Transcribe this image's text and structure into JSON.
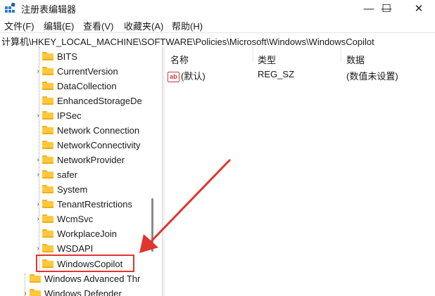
{
  "window": {
    "title": "注册表编辑器",
    "minimize": "—",
    "maximize": "☐",
    "close": "✕"
  },
  "menu": [
    "文件(F)",
    "编辑(E)",
    "查看(V)",
    "收藏夹(A)",
    "帮助(H)"
  ],
  "address": "计算机\\HKEY_LOCAL_MACHINE\\SOFTWARE\\Policies\\Microsoft\\Windows\\WindowsCopilot",
  "tree": {
    "items": [
      {
        "label": "BITS",
        "expandable": false
      },
      {
        "label": "CurrentVersion",
        "expandable": true
      },
      {
        "label": "DataCollection",
        "expandable": false
      },
      {
        "label": "EnhancedStorageDe",
        "expandable": false
      },
      {
        "label": "IPSec",
        "expandable": true
      },
      {
        "label": "Network Connection",
        "expandable": false
      },
      {
        "label": "NetworkConnectivity",
        "expandable": false
      },
      {
        "label": "NetworkProvider",
        "expandable": true
      },
      {
        "label": "safer",
        "expandable": true
      },
      {
        "label": "System",
        "expandable": false
      },
      {
        "label": "TenantRestrictions",
        "expandable": true
      },
      {
        "label": "WcmSvc",
        "expandable": true
      },
      {
        "label": "WorkplaceJoin",
        "expandable": false
      },
      {
        "label": "WSDAPI",
        "expandable": true
      },
      {
        "label": "WindowsCopilot",
        "expandable": false,
        "selected": true
      }
    ],
    "siblings": [
      {
        "label": "Windows Advanced Thr",
        "expandable": false
      },
      {
        "label": "Windows Defender",
        "expandable": true
      }
    ]
  },
  "columns": {
    "name": "名称",
    "type": "类型",
    "data": "数据"
  },
  "values": [
    {
      "name": "(默认)",
      "type": "REG_SZ",
      "data": "(数值未设置)",
      "icon": "string-value-icon"
    }
  ],
  "colors": {
    "highlight": "#e1352f",
    "folder": "#ffc83d"
  }
}
